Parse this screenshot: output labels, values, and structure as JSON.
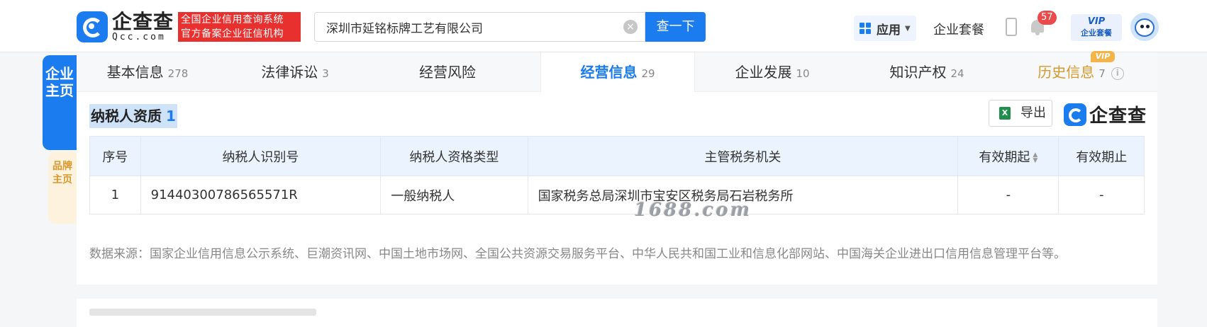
{
  "header": {
    "logo_cn": "企查查",
    "logo_en": "Qcc.com",
    "slogan_line1": "全国企业信用查询系统",
    "slogan_line2": "官方备案企业征信机构",
    "search_value": "深圳市延铭标牌工艺有限公司",
    "search_button": "查一下",
    "app_button": "应用",
    "package_link": "企业套餐",
    "notification_count": "57",
    "vip_line1": "VIP",
    "vip_line2": "企业套餐"
  },
  "side": {
    "main_tab": "企业主页",
    "brand_tab": "品牌主页"
  },
  "tabs": [
    {
      "label": "基本信息",
      "count": "278"
    },
    {
      "label": "法律诉讼",
      "count": "3"
    },
    {
      "label": "经营风险",
      "count": ""
    },
    {
      "label": "经营信息",
      "count": "29"
    },
    {
      "label": "企业发展",
      "count": "10"
    },
    {
      "label": "知识产权",
      "count": "24"
    },
    {
      "label": "历史信息",
      "count": "7"
    }
  ],
  "vip_tag": "VIP",
  "section": {
    "title": "纳税人资质",
    "count": "1",
    "export_label": "导出",
    "brand": "企查查"
  },
  "table": {
    "headers": [
      "序号",
      "纳税人识别号",
      "纳税人资格类型",
      "主管税务机关",
      "有效期起",
      "有效期止"
    ],
    "rows": [
      [
        "1",
        "91440300786565571R",
        "一般纳税人",
        "国家税务总局深圳市宝安区税务局石岩税务所",
        "-",
        "-"
      ]
    ]
  },
  "watermark": "1688.com",
  "source_text": "数据来源：国家企业信用信息公示系统、巨潮资讯网、中国土地市场网、全国公共资源交易服务平台、中华人民共和国工业和信息化部网站、中国海关企业进出口信用信息管理平台等。",
  "colors": {
    "brand_blue": "#1b7cf0",
    "vip_gold": "#d9982b",
    "slogan_red": "#e8302f"
  }
}
